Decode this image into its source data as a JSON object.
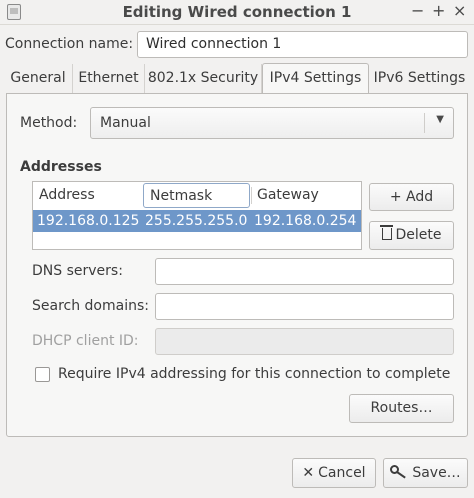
{
  "window": {
    "title": "Editing Wired connection 1",
    "minimize": "−",
    "maximize": "+",
    "close": "×"
  },
  "connection_name": {
    "label": "Connection name:",
    "value": "Wired connection 1"
  },
  "tabs": [
    {
      "label": "General"
    },
    {
      "label": "Ethernet"
    },
    {
      "label": "802.1x Security"
    },
    {
      "label": "IPv4 Settings",
      "active": true
    },
    {
      "label": "IPv6 Settings"
    }
  ],
  "method": {
    "label": "Method:",
    "value": "Manual",
    "arrow": "▼"
  },
  "addresses": {
    "heading": "Addresses",
    "columns": [
      "Address",
      "Netmask",
      "Gateway"
    ],
    "rows": [
      {
        "address": "192.168.0.125",
        "netmask": "255.255.255.0",
        "gateway": "192.168.0.254"
      }
    ],
    "add_label": "Add",
    "add_icon": "+",
    "delete_label": "Delete"
  },
  "fields": {
    "dns_label": "DNS servers:",
    "dns_value": "",
    "search_label": "Search domains:",
    "search_value": "",
    "dhcp_label": "DHCP client ID:",
    "dhcp_value": ""
  },
  "require_ipv4": {
    "label": "Require IPv4 addressing for this connection to complete",
    "checked": false
  },
  "routes_label": "Routes…",
  "footer": {
    "cancel_label": "Cancel",
    "cancel_icon": "✕",
    "save_label": "Save…"
  }
}
